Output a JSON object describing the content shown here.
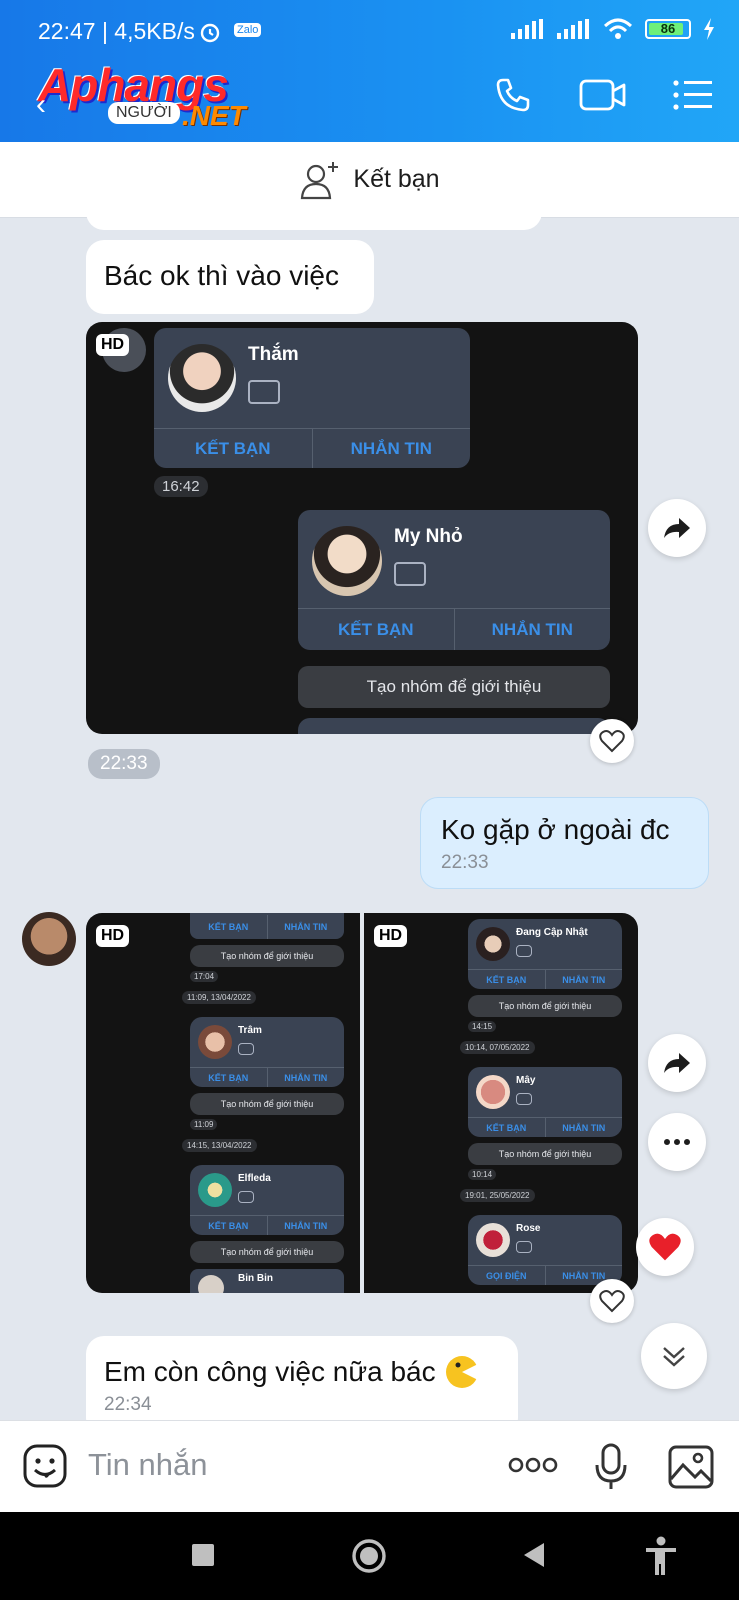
{
  "status_bar": {
    "time": "22:47 | 4,5KB/s",
    "app_badge": "Zalo",
    "battery": "86"
  },
  "header": {
    "brand": "Aphangs",
    "brand_sub": "NGƯỜI",
    "brand_net": ".NET",
    "icons": [
      "back-icon",
      "phone-icon",
      "video-call-icon",
      "menu-list-icon"
    ]
  },
  "friend_bar": {
    "label": "Kết bạn"
  },
  "messages": {
    "m1": {
      "text": "Bác ok thì vào việc"
    },
    "img1_time": "22:33",
    "m2": {
      "text": "Ko gặp ở ngoài đc",
      "time": "22:33"
    },
    "m3": {
      "text": "Em còn công việc nữa bác",
      "time": "22:34"
    }
  },
  "shot1": {
    "hd": "HD",
    "card1": {
      "name": "Thắm",
      "friend": "KẾT BẠN",
      "msg": "NHẮN TIN",
      "time": "16:42"
    },
    "card2": {
      "name": "My Nhỏ",
      "friend": "KẾT BẠN",
      "msg": "NHẮN TIN"
    },
    "group_pill": "Tạo nhóm để giới thiệu"
  },
  "shot2": {
    "hd": "HD",
    "top_actions": {
      "friend": "KẾT BẠN",
      "msg": "NHẮN TIN"
    },
    "pill1": "Tạo nhóm để giới thiệu",
    "t1": "17:04",
    "d1": "11:09, 13/04/2022",
    "card_a": {
      "name": "Trâm",
      "friend": "KẾT BẠN",
      "msg": "NHẮN TIN"
    },
    "pill2": "Tạo nhóm để giới thiệu",
    "t2": "11:09",
    "d2": "14:15, 13/04/2022",
    "card_b": {
      "name": "Elfleda",
      "friend": "KẾT BẠN",
      "msg": "NHẮN TIN"
    },
    "pill3": "Tạo nhóm để giới thiệu",
    "card_c": {
      "name": "Bin Bin"
    }
  },
  "shot3": {
    "hd": "HD",
    "card_a": {
      "name": "Đang Cập Nhật",
      "friend": "KẾT BẠN",
      "msg": "NHẮN TIN"
    },
    "pill1": "Tạo nhóm để giới thiệu",
    "t1": "14:15",
    "d1": "10:14, 07/05/2022",
    "card_b": {
      "name": "Mây",
      "friend": "KẾT BẠN",
      "msg": "NHẮN TIN"
    },
    "pill2": "Tạo nhóm để giới thiệu",
    "t2": "10:14",
    "d2": "19:01, 25/05/2022",
    "card_c": {
      "name": "Rose",
      "call": "GỌI ĐIỆN",
      "msg": "NHẮN TIN"
    }
  },
  "input": {
    "placeholder": "Tin nhắn"
  },
  "colors": {
    "header": "#1a8ef0",
    "my_bubble": "#dbeefe",
    "accent": "#3a8fe8",
    "heart": "#e8202a"
  }
}
